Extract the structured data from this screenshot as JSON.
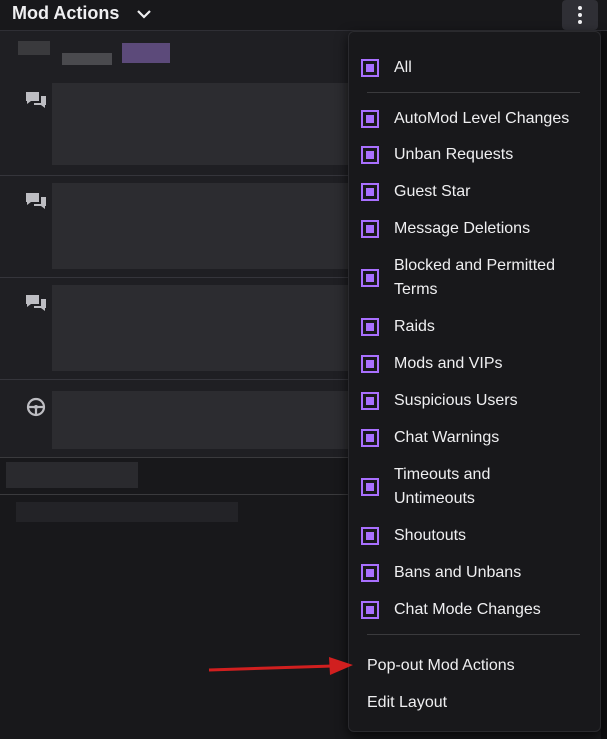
{
  "header": {
    "title": "Mod Actions",
    "chevron_icon": "chevron-down-icon",
    "more_icon": "more-vertical-icon"
  },
  "entries": [
    {
      "icon": "chat-bubbles-icon"
    },
    {
      "icon": "chat-bubbles-icon"
    },
    {
      "icon": "chat-bubbles-icon"
    },
    {
      "icon": "steering-wheel-icon"
    }
  ],
  "menu": {
    "all_label": "All",
    "filters": [
      {
        "label": "AutoMod Level Changes",
        "checked": true
      },
      {
        "label": "Unban Requests",
        "checked": true
      },
      {
        "label": "Guest Star",
        "checked": true
      },
      {
        "label": "Message Deletions",
        "checked": true
      },
      {
        "label_line1": "Blocked and Permitted",
        "label_line2": "Terms",
        "checked": true
      },
      {
        "label": "Raids",
        "checked": true
      },
      {
        "label": "Mods and VIPs",
        "checked": true
      },
      {
        "label": "Suspicious Users",
        "checked": true
      },
      {
        "label": "Chat Warnings",
        "checked": true
      },
      {
        "label_line1": "Timeouts and",
        "label_line2": "Untimeouts",
        "checked": true
      },
      {
        "label": "Shoutouts",
        "checked": true
      },
      {
        "label": "Bans and Unbans",
        "checked": true
      },
      {
        "label": "Chat Mode Changes",
        "checked": true
      }
    ],
    "actions": {
      "popout": "Pop-out Mod Actions",
      "edit_layout": "Edit Layout"
    }
  },
  "colors": {
    "accent": "#a970ff",
    "background": "#18181b",
    "annotation_arrow": "#d11f1f"
  }
}
